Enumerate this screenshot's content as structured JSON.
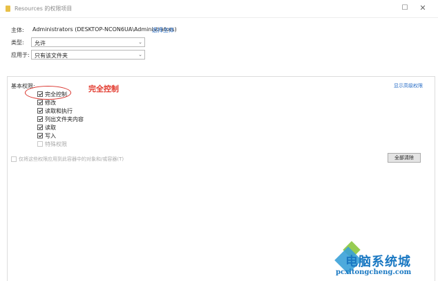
{
  "window": {
    "title": "Resources 的权限项目",
    "icons": {
      "folder": "folder-icon",
      "maximize": "maximize-icon",
      "close": "close-icon"
    }
  },
  "principal": {
    "label": "主体:",
    "value": "Administrators (DESKTOP-NCON6UA\\Administrators)",
    "select_link": "选择主体"
  },
  "type": {
    "label": "类型:",
    "value": "允许"
  },
  "applies_to": {
    "label": "应用于:",
    "value": "只有该文件夹"
  },
  "basic_permissions": {
    "heading": "基本权限:",
    "advanced_link": "显示高级权限",
    "items": [
      {
        "label": "完全控制",
        "checked": true,
        "enabled": true
      },
      {
        "label": "修改",
        "checked": true,
        "enabled": true
      },
      {
        "label": "读取和执行",
        "checked": true,
        "enabled": true
      },
      {
        "label": "列出文件夹内容",
        "checked": true,
        "enabled": true
      },
      {
        "label": "读取",
        "checked": true,
        "enabled": true
      },
      {
        "label": "写入",
        "checked": true,
        "enabled": true
      },
      {
        "label": "特殊权限",
        "checked": false,
        "enabled": false
      }
    ]
  },
  "annotation": {
    "text": "完全控制",
    "color": "#e23a2e"
  },
  "apply_option": {
    "label": "仅将这些权限应用到此容器中的对象和/或容器(T)",
    "checked": false,
    "enabled": false
  },
  "clear_all_label": "全部清除",
  "watermark": {
    "title": "电脑系统城",
    "domain": "pcxitongcheng.com"
  },
  "colors": {
    "link": "#2b6fc7",
    "annotation": "#e23a2e",
    "watermark": "#1a78c2"
  }
}
